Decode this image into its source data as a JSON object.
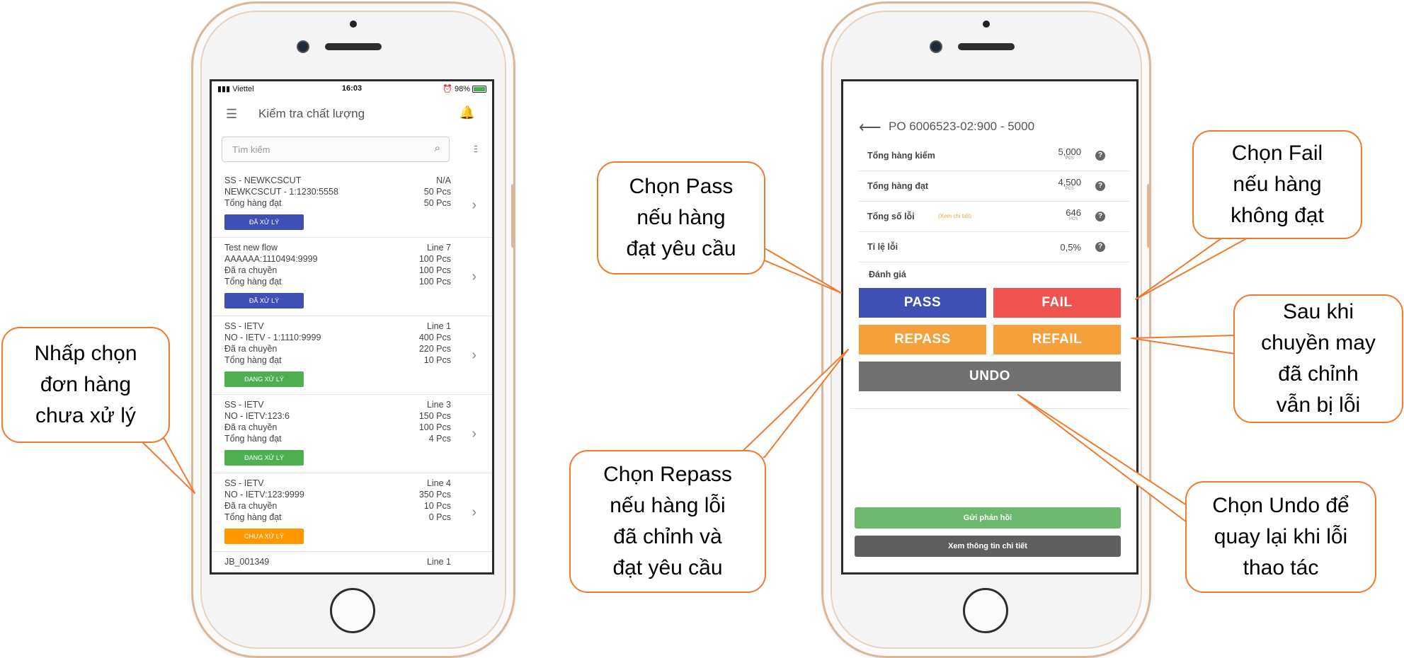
{
  "left_phone": {
    "status": {
      "carrier": "Viettel",
      "time": "16:03",
      "battery": "98%"
    },
    "appbar": {
      "menu_icon": "☰",
      "title": "Kiểm tra chất lượng",
      "bell_icon": "🔔"
    },
    "search": {
      "placeholder": "Tìm kiếm",
      "icon": "⌕",
      "filter_icon": "⫶⫶⫶"
    },
    "orders": [
      {
        "rows": [
          [
            "SS - NEWKCSCUT",
            "N/A"
          ],
          [
            "NEWKCSCUT - 1:1230:5558",
            "50 Pcs"
          ],
          [
            "Tổng hàng đạt",
            "50 Pcs"
          ]
        ],
        "status": "ĐÃ XỬ LÝ",
        "status_color": "#3f4fb5"
      },
      {
        "rows": [
          [
            "Test new flow",
            "Line 7"
          ],
          [
            "AAAAAA:1110494:9999",
            "100 Pcs"
          ],
          [
            "Đã ra chuyền",
            "100 Pcs"
          ],
          [
            "Tổng hàng đạt",
            "100 Pcs"
          ]
        ],
        "status": "ĐÃ XỬ LÝ",
        "status_color": "#3f4fb5"
      },
      {
        "rows": [
          [
            "SS - IETV",
            "Line 1"
          ],
          [
            "NO - IETV - 1:1110:9999",
            "400 Pcs"
          ],
          [
            "Đã ra chuyền",
            "220 Pcs"
          ],
          [
            "Tổng hàng đạt",
            "10 Pcs"
          ]
        ],
        "status": "ĐANG XỬ LÝ",
        "status_color": "#4caf50"
      },
      {
        "rows": [
          [
            "SS - IETV",
            "Line 3"
          ],
          [
            "NO - IETV:123:6",
            "150 Pcs"
          ],
          [
            "Đã ra chuyền",
            "100 Pcs"
          ],
          [
            "Tổng hàng đạt",
            "4 Pcs"
          ]
        ],
        "status": "ĐANG XỬ LÝ",
        "status_color": "#4caf50"
      },
      {
        "rows": [
          [
            "SS - IETV",
            "Line 4"
          ],
          [
            "NO - IETV:123:9999",
            "350 Pcs"
          ],
          [
            "Đã ra chuyền",
            "10 Pcs"
          ],
          [
            "Tổng hàng đạt",
            "0 Pcs"
          ]
        ],
        "status": "CHƯA XỬ LÝ",
        "status_color": "#ff9800"
      },
      {
        "rows": [
          [
            "JB_001349",
            "Line 1"
          ]
        ],
        "status": "",
        "status_color": ""
      }
    ]
  },
  "right_phone": {
    "back_icon": "⟵",
    "title": "PO 6006523-02:900 - 5000",
    "stats": [
      {
        "label": "Tổng hàng kiểm",
        "value": "5,000",
        "unit": "PCS",
        "link": ""
      },
      {
        "label": "Tổng hàng đạt",
        "value": "4,500",
        "unit": "PCS",
        "link": ""
      },
      {
        "label": "Tổng số lỗi",
        "value": "646",
        "unit": "PCS",
        "link": "(Xem chi tiết)"
      },
      {
        "label": "Tỉ lệ lỗi",
        "value": "0,5%",
        "unit": "",
        "link": ""
      }
    ],
    "help_icon": "?",
    "eval_label": "Đánh giá",
    "buttons": {
      "pass": "PASS",
      "fail": "FAIL",
      "repass": "REPASS",
      "refail": "REFAIL",
      "undo": "UNDO"
    },
    "bottom": {
      "feedback": "Gửi phản hồi",
      "details": "Xem thông tin chi tiết"
    }
  },
  "callouts": {
    "select_order": "Nhấp chọn\nđơn hàng\nchưa xử lý",
    "pass": "Chọn Pass\nnếu hàng\nđạt yêu cầu",
    "repass": "Chọn Repass\nnếu hàng lỗi\nđã chỉnh và\nđạt yêu cầu",
    "fail": "Chọn Fail\nnếu hàng\nkhông đạt",
    "refail": "Sau khi\nchuyền may\nđã chỉnh\nvẫn bị lỗi",
    "undo": "Chọn Undo để\nquay lại khi lỗi\nthao tác"
  },
  "colors": {
    "pass": "#3f4fb5",
    "fail": "#ef5350",
    "repass": "#f5a03a",
    "refail": "#f5a03a",
    "undo": "#707070",
    "feedback": "#6cb86c",
    "details": "#5f5f5f",
    "callout_border": "#f07a2d"
  }
}
